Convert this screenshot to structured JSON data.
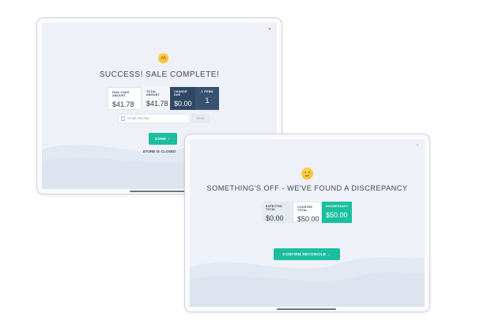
{
  "sale_complete": {
    "title": "SUCCESS! SALE COMPLETE!",
    "close_glyph": "×",
    "stats": [
      {
        "label": "PAID CASH AMOUNT",
        "value": "$41.78"
      },
      {
        "label": "TOTAL AMOUNT",
        "value": "$41.78"
      },
      {
        "label": "CHANGE DUE",
        "value": "$0.00"
      },
      {
        "label": "1 ITEMS",
        "value": "1"
      }
    ],
    "email_placeholder": "Email Receipt",
    "send_label": "SEND",
    "done_label": "DONE ✓",
    "status_text": "STORE IS CLOSED"
  },
  "discrepancy": {
    "title": "SOMETHING'S OFF - WE'VE FOUND A DISCREPANCY",
    "chevron_glyph": "⌄",
    "stats": [
      {
        "label": "EXPECTED TOTAL",
        "value": "$0.00"
      },
      {
        "label": "COUNTED TOTAL",
        "value": "$50.00"
      },
      {
        "label": "DISCREPANCY",
        "value": "$50.00"
      }
    ],
    "confirm_label": "CONFIRM RECONCILE →"
  }
}
